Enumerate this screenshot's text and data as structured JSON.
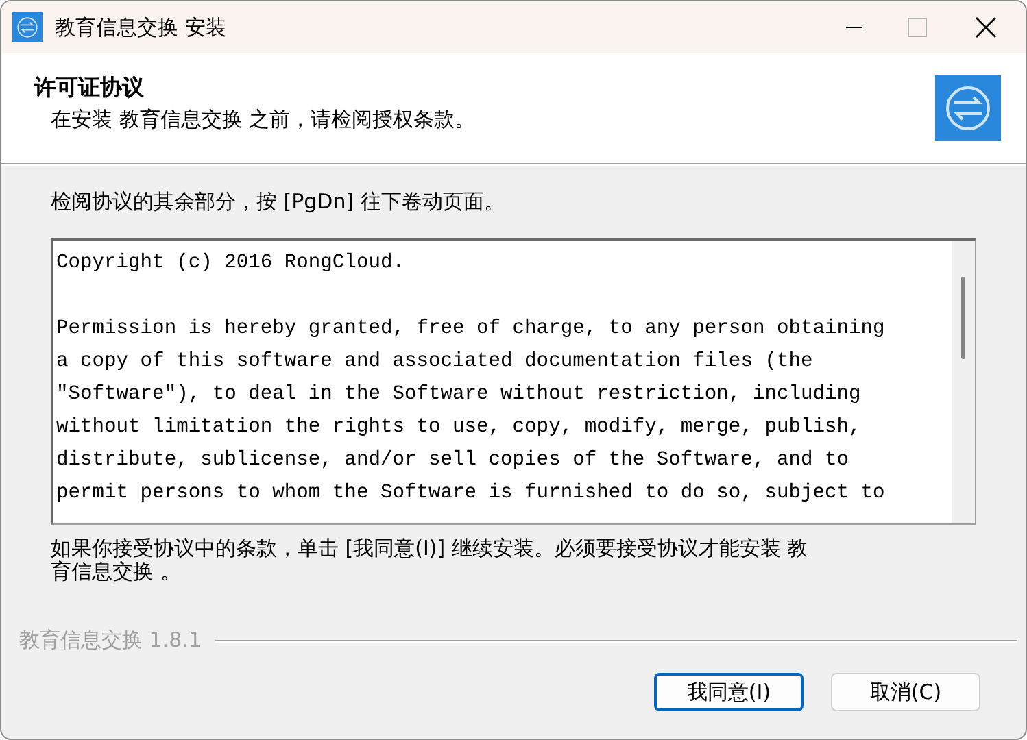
{
  "window": {
    "title": "教育信息交换 安装"
  },
  "header": {
    "title": "许可证协议",
    "subtitle": "在安装 教育信息交换 之前，请检阅授权条款。"
  },
  "instruction": "检阅协议的其余部分，按 [PgDn] 往下卷动页面。",
  "license_paragraphs": [
    [
      "Copyright (c) 2016 RongCloud."
    ],
    [
      "Permission is hereby granted, free of charge, to any person obtaining",
      "a copy of this software and associated documentation files (the",
      "\"Software\"), to deal in the Software without restriction, including",
      "without limitation the rights to use, copy, modify, merge, publish,",
      "distribute, sublicense, and/or sell copies of the Software, and to",
      "permit persons to whom the Software is furnished to do so, subject to"
    ]
  ],
  "notice": "如果你接受协议中的条款，单击 [我同意(I)] 继续安装。必须要接受协议才能安装 教育信息交换 。",
  "branding": "教育信息交换 1.8.1",
  "buttons": [
    {
      "label": "我同意(I)",
      "default": true
    },
    {
      "label": "取消(C)",
      "default": false
    }
  ]
}
